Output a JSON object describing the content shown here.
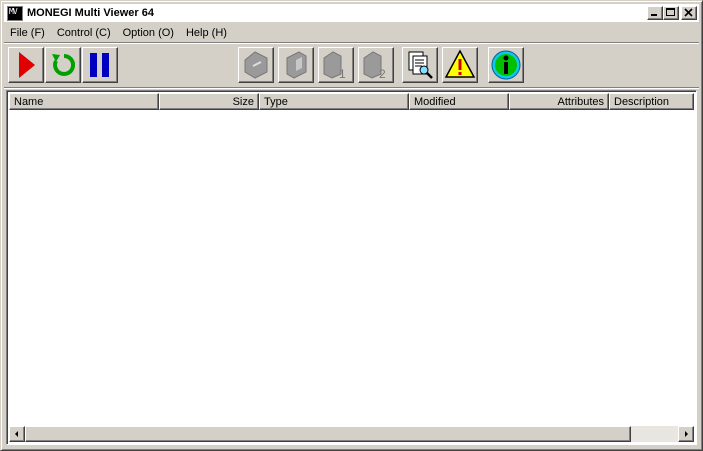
{
  "window": {
    "title": "MONEGI Multi Viewer 64",
    "icon_text": "MV"
  },
  "menu": [
    "File (F)",
    "Control (C)",
    "Option (O)",
    "Help (H)"
  ],
  "toolbar": {
    "buttons": [
      {
        "name": "play-button",
        "icon": "play-icon",
        "color": "#e00000"
      },
      {
        "name": "refresh-button",
        "icon": "refresh-icon",
        "color": "#00a000"
      },
      {
        "name": "pause-button",
        "icon": "pause-icon",
        "color": "#0000c0"
      },
      {
        "name": "disc-button",
        "icon": "disc-icon",
        "enabled": false
      },
      {
        "name": "tape-button",
        "icon": "tape-icon",
        "enabled": false
      },
      {
        "name": "drive-1-button",
        "icon": "drive-1-icon",
        "enabled": false
      },
      {
        "name": "drive-2-button",
        "icon": "drive-2-icon",
        "enabled": false
      },
      {
        "name": "inspect-button",
        "icon": "document-search-icon"
      },
      {
        "name": "warning-button",
        "icon": "warning-icon",
        "color": "#ffff00"
      },
      {
        "name": "info-button",
        "icon": "info-icon",
        "color": "#00c000"
      }
    ]
  },
  "columns": [
    "Name",
    "Size",
    "Type",
    "Modified",
    "Attributes",
    "Description"
  ],
  "rows": []
}
